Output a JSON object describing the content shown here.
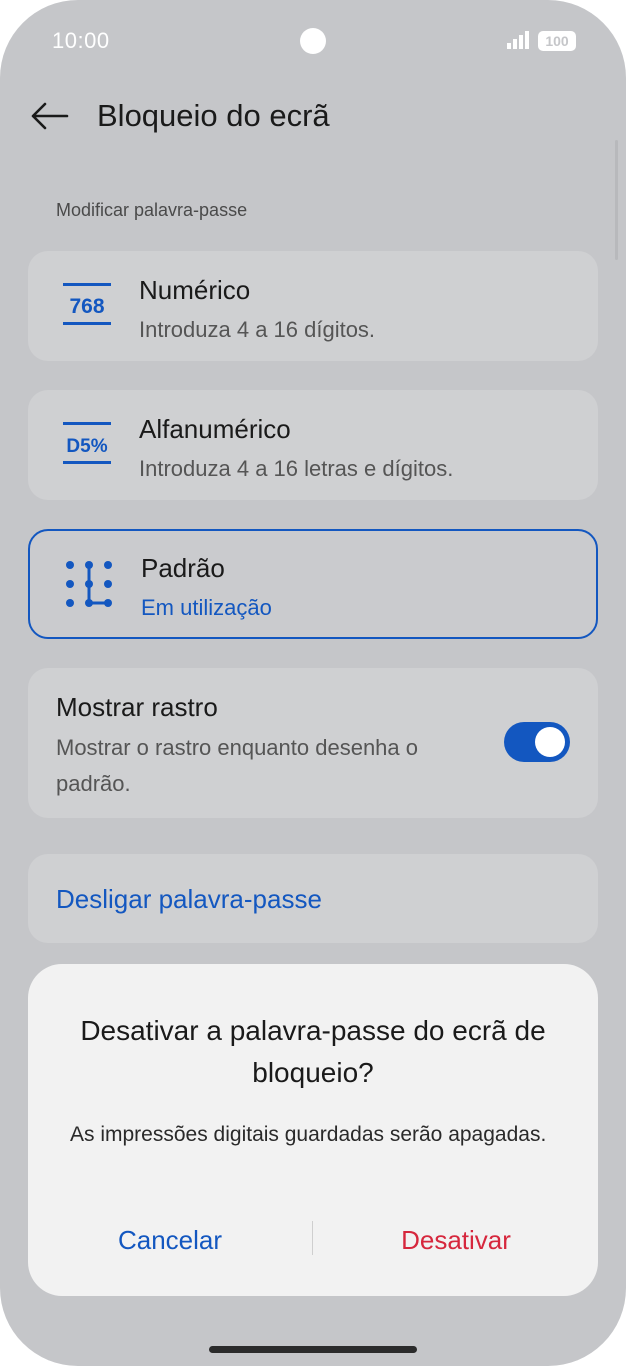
{
  "status_bar": {
    "time": "10:00",
    "battery": "100",
    "icons": [
      "signal-icon",
      "battery-icon"
    ]
  },
  "header": {
    "title": "Bloqueio do ecrã",
    "back_icon": "arrow-left-icon"
  },
  "section_label": "Modificar palavra-passe",
  "options": [
    {
      "icon": "numeric-768-icon",
      "icon_text": "768",
      "title": "Numérico",
      "subtitle": "Introduza 4 a 16 dígitos.",
      "selected": false
    },
    {
      "icon": "alphanumeric-d5-icon",
      "icon_text": "D5%",
      "title": "Alfanumérico",
      "subtitle": "Introduza 4 a 16 letras e dígitos.",
      "selected": false
    },
    {
      "icon": "pattern-icon",
      "title": "Padrão",
      "subtitle": "Em utilização",
      "selected": true
    }
  ],
  "show_trace": {
    "title": "Mostrar rastro",
    "description": "Mostrar o rastro enquanto desenha o padrão.",
    "enabled": true
  },
  "disable_link": "Desligar palavra-passe",
  "dialog": {
    "title": "Desativar a palavra-passe do ecrã de bloqueio?",
    "message": "As impressões digitais guardadas serão apagadas.",
    "cancel_label": "Cancelar",
    "confirm_label": "Desativar"
  },
  "colors": {
    "accent": "#1357c0",
    "destructive": "#d6273d",
    "background": "#c5c6c9",
    "card": "#cfd0d2",
    "dialog": "#f2f2f2"
  }
}
